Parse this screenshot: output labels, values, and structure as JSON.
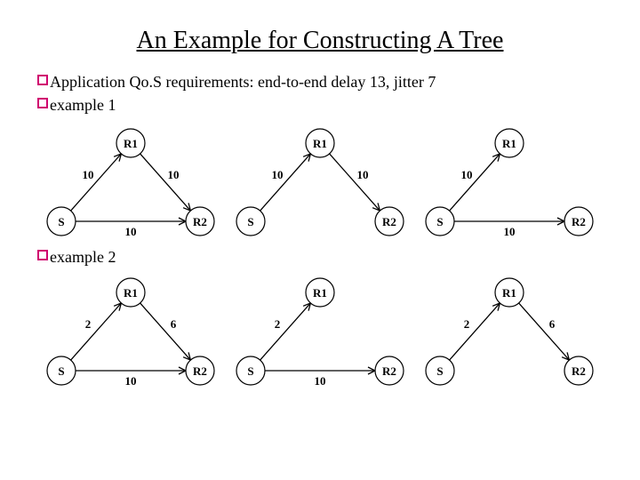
{
  "title": "An Example for Constructing A Tree",
  "bullets": [
    "Application Qo.S requirements: end-to-end delay 13, jitter 7",
    "example 1"
  ],
  "example2_label": "example 2",
  "node_labels": {
    "S": "S",
    "R1": "R1",
    "R2": "R2"
  },
  "chart_data": [
    {
      "type": "diagram",
      "title": "example 1",
      "graphs": [
        {
          "edges": [
            {
              "from": "S",
              "to": "R1",
              "weight": 10,
              "present": true
            },
            {
              "from": "R1",
              "to": "R2",
              "weight": 10,
              "present": true
            },
            {
              "from": "S",
              "to": "R2",
              "weight": 10,
              "present": true
            }
          ]
        },
        {
          "edges": [
            {
              "from": "S",
              "to": "R1",
              "weight": 10,
              "present": true
            },
            {
              "from": "R1",
              "to": "R2",
              "weight": 10,
              "present": true
            },
            {
              "from": "S",
              "to": "R2",
              "weight": null,
              "present": false
            }
          ]
        },
        {
          "edges": [
            {
              "from": "S",
              "to": "R1",
              "weight": 10,
              "present": true
            },
            {
              "from": "R1",
              "to": "R2",
              "weight": null,
              "present": false
            },
            {
              "from": "S",
              "to": "R2",
              "weight": 10,
              "present": true
            }
          ]
        }
      ]
    },
    {
      "type": "diagram",
      "title": "example 2",
      "graphs": [
        {
          "edges": [
            {
              "from": "S",
              "to": "R1",
              "weight": 2,
              "present": true
            },
            {
              "from": "R1",
              "to": "R2",
              "weight": 6,
              "present": true
            },
            {
              "from": "S",
              "to": "R2",
              "weight": 10,
              "present": true
            }
          ]
        },
        {
          "edges": [
            {
              "from": "S",
              "to": "R1",
              "weight": 2,
              "present": true
            },
            {
              "from": "R1",
              "to": "R2",
              "weight": null,
              "present": false
            },
            {
              "from": "S",
              "to": "R2",
              "weight": 10,
              "present": true
            }
          ]
        },
        {
          "edges": [
            {
              "from": "S",
              "to": "R1",
              "weight": 2,
              "present": true
            },
            {
              "from": "R1",
              "to": "R2",
              "weight": 6,
              "present": true
            },
            {
              "from": "S",
              "to": "R2",
              "weight": null,
              "present": false
            }
          ]
        }
      ]
    }
  ]
}
